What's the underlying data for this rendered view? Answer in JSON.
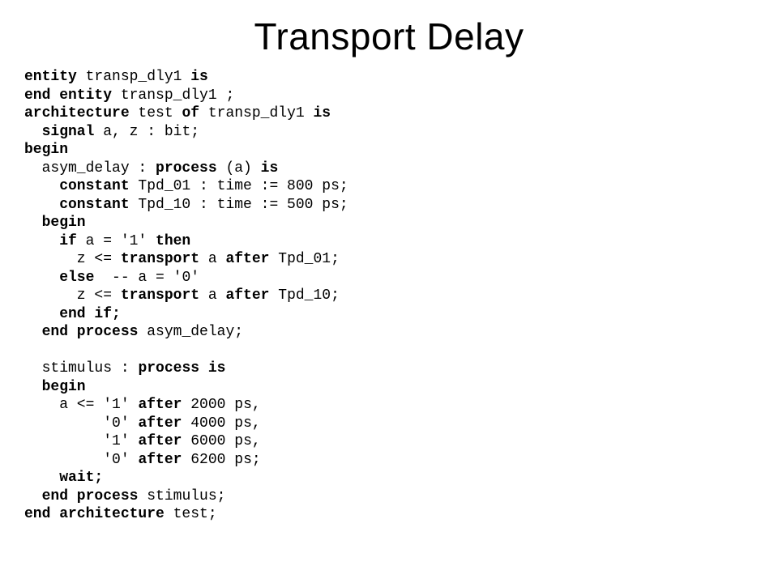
{
  "title": "Transport Delay",
  "code": {
    "l01_kw1": "entity",
    "l01_id": " transp_dly1 ",
    "l01_kw2": "is",
    "l02_kw1": "end entity",
    "l02_id": " transp_dly1 ;",
    "l03_kw1": "architecture",
    "l03_mid": " test ",
    "l03_kw2": "of",
    "l03_mid2": " transp_dly1 ",
    "l03_kw3": "is",
    "l04_kw": "  signal",
    "l04_rest": " a, z : bit;",
    "l05_kw": "begin",
    "l06_pre": "  asym_delay : ",
    "l06_kw": "process",
    "l06_mid": " (a) ",
    "l06_kw2": "is",
    "l07_kw": "    constant",
    "l07_rest": " Tpd_01 : time := 800 ps;",
    "l08_kw": "    constant",
    "l08_rest": " Tpd_10 : time := 500 ps;",
    "l09_kw": "  begin",
    "l10_kw1": "    if",
    "l10_mid": " a = '1' ",
    "l10_kw2": "then",
    "l11_pre": "      z <= ",
    "l11_kw1": "transport",
    "l11_mid": " a ",
    "l11_kw2": "after",
    "l11_rest": " Tpd_01;",
    "l12_kw": "    else",
    "l12_rest": "  -- a = '0'",
    "l13_pre": "      z <= ",
    "l13_kw1": "transport",
    "l13_mid": " a ",
    "l13_kw2": "after",
    "l13_rest": " Tpd_10;",
    "l14_kw": "    end if;",
    "l15_kw": "  end process",
    "l15_rest": " asym_delay;",
    "blank": "",
    "l17_pre": "  stimulus : ",
    "l17_kw": "process is",
    "l18_kw": "  begin",
    "l19_pre": "    a <= '1' ",
    "l19_kw": "after",
    "l19_rest": " 2000 ps,",
    "l20_pre": "         '0' ",
    "l20_kw": "after",
    "l20_rest": " 4000 ps,",
    "l21_pre": "         '1' ",
    "l21_kw": "after",
    "l21_rest": " 6000 ps,",
    "l22_pre": "         '0' ",
    "l22_kw": "after",
    "l22_rest": " 6200 ps;",
    "l23_kw": "    wait;",
    "l24_kw": "  end process",
    "l24_rest": " stimulus;",
    "l25_kw": "end architecture",
    "l25_rest": " test;"
  }
}
